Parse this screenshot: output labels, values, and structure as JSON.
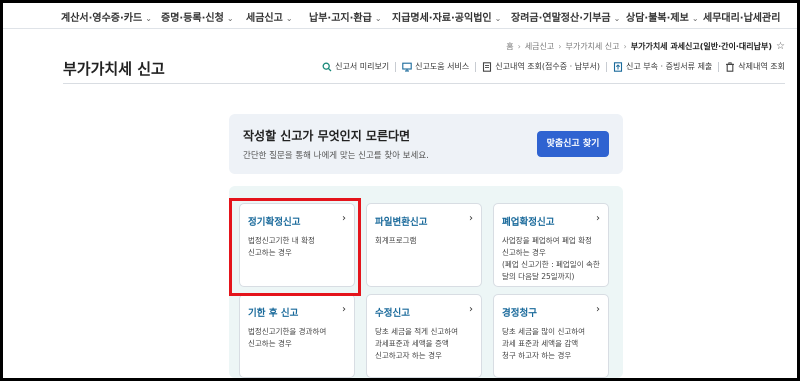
{
  "nav": {
    "items": [
      {
        "label": "계산서·영수증·카드"
      },
      {
        "label": "증명·등록·신청"
      },
      {
        "label": "세금신고"
      },
      {
        "label": "납부·고지·환급"
      },
      {
        "label": "지급명세·자료·공익법인"
      },
      {
        "label": "장려금·연말정산·기부금"
      },
      {
        "label": "상담·불복·제보"
      },
      {
        "label": "세무대리·납세관리"
      }
    ]
  },
  "breadcrumb": {
    "home": "홈",
    "items": [
      "세금신고",
      "부가가치세 신고"
    ],
    "current": "부가가치세 과세신고(일반·간이·대리납부)"
  },
  "page": {
    "title": "부가가치세 신고"
  },
  "toolbar": {
    "links": [
      {
        "label": "신고서 미리보기",
        "icon": "magnifier-icon"
      },
      {
        "label": "신고도움 서비스",
        "icon": "monitor-icon"
      },
      {
        "label": "신고내역 조회(접수증 · 납부서)",
        "icon": "document-icon"
      },
      {
        "label": "신고 부속 · 증빙서류 제출",
        "icon": "document-upload-icon"
      },
      {
        "label": "삭제내역 조회",
        "icon": "trash-icon"
      }
    ]
  },
  "finder": {
    "title": "작성할 신고가 무엇인지 모른다면",
    "description": "간단한 질문을 통해 나에게 맞는 신고를 찾아 보세요.",
    "button_label": "맞춤신고 찾기"
  },
  "cards": [
    {
      "title": "정기확정신고",
      "arrow": "›",
      "lines": [
        "법정신고기한 내 확정",
        "신고하는 경우"
      ]
    },
    {
      "title": "파일변환신고",
      "arrow": "›",
      "lines": [
        "회계프로그램"
      ]
    },
    {
      "title": "폐업확정신고",
      "arrow": "›",
      "lines": [
        "사업장을 폐업하여 폐업 확정",
        "신고하는 경우",
        "(폐업 신고기한 : 폐업일이 속한",
        "달의 다음달 25일까지)"
      ]
    },
    {
      "title": "기한 후 신고",
      "arrow": "›",
      "lines": [
        "법정신고기한을 경과하여",
        "신고하는 경우"
      ]
    },
    {
      "title": "수정신고",
      "arrow": "›",
      "lines": [
        "당초 세금을 적게 신고하여",
        "과세표준과 세액을 증액",
        "신고하고자 하는 경우"
      ]
    },
    {
      "title": "경정청구",
      "arrow": "›",
      "lines": [
        "당초 세금을 많이 신고하여",
        "과세 표준과 세액을 감액",
        "청구 하고자 하는 경우"
      ]
    }
  ],
  "colors": {
    "accent_blue": "#2f63d1",
    "card_title": "#1a6a9b",
    "highlight_red": "#e4141b",
    "grid_bg": "#edf6f6",
    "finder_bg": "#eef2f7"
  }
}
